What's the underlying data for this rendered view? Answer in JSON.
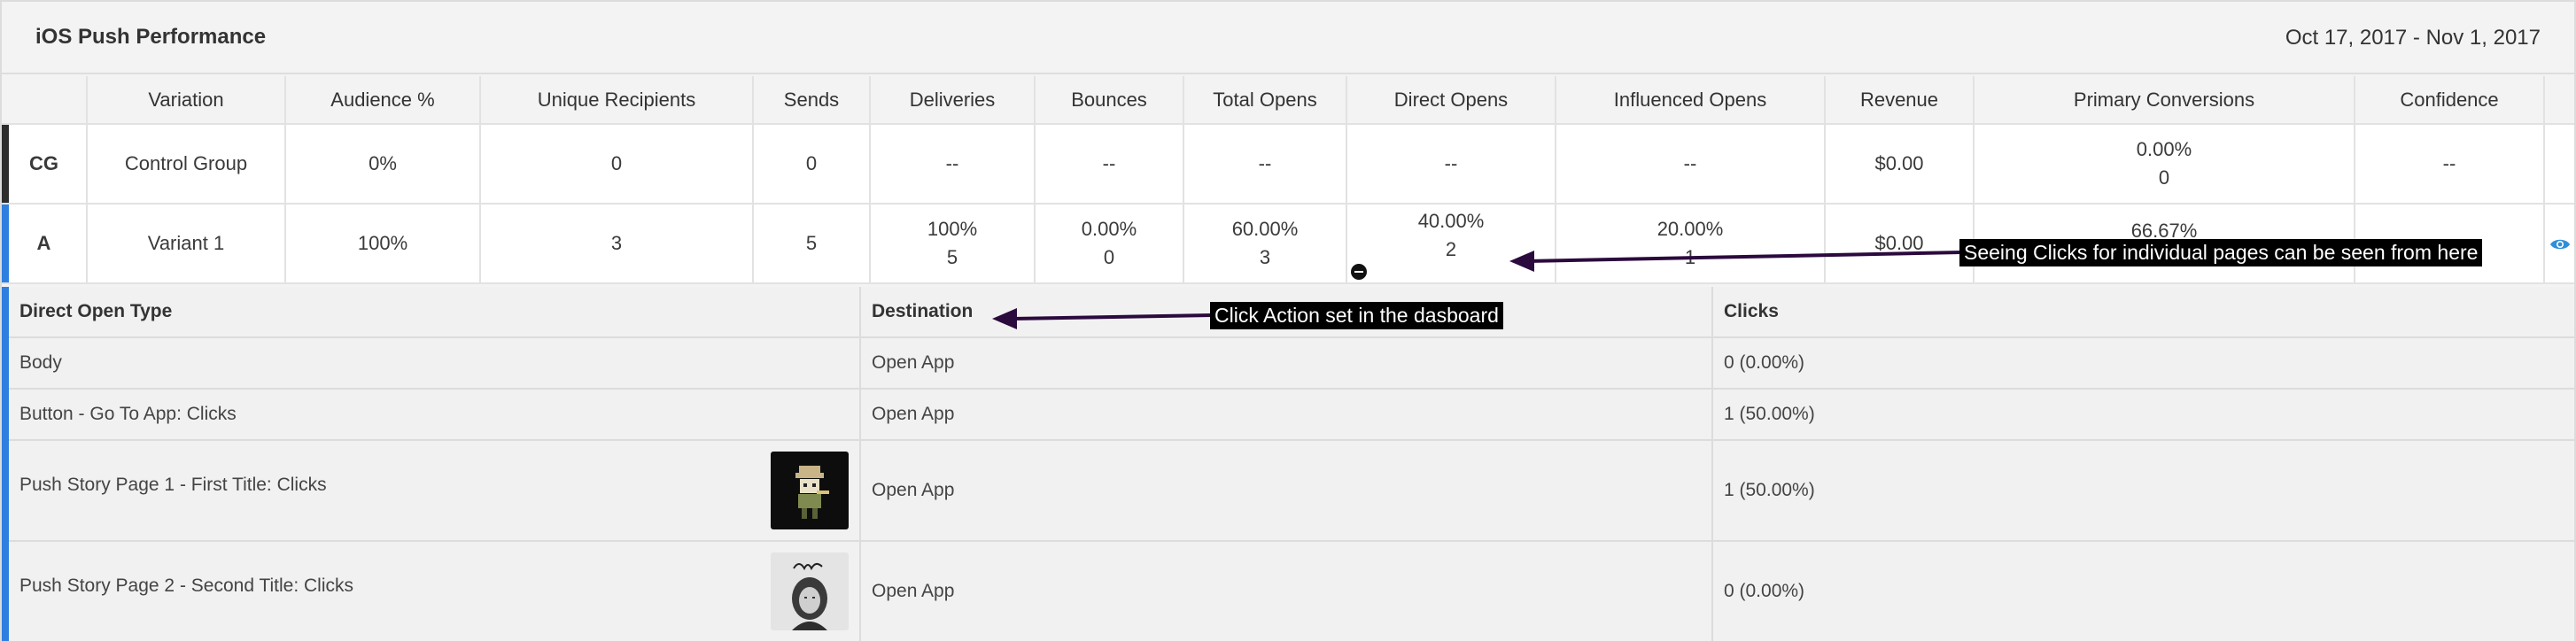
{
  "header": {
    "title": "iOS Push Performance",
    "date_range": "Oct 17, 2017 - Nov 1, 2017"
  },
  "metrics": {
    "columns": [
      "",
      "Variation",
      "Audience %",
      "Unique Recipients",
      "Sends",
      "Deliveries",
      "Bounces",
      "Total Opens",
      "Direct Opens",
      "Influenced Opens",
      "Revenue",
      "Primary Conversions",
      "Confidence",
      ""
    ],
    "rows": [
      {
        "key": "CG",
        "variation": "Control Group",
        "audience": "0%",
        "unique_recipients": "0",
        "sends": "0",
        "deliveries": "--",
        "bounces": "--",
        "total_opens": "--",
        "direct_opens": "--",
        "influenced_opens": "--",
        "revenue": "$0.00",
        "primary_conversions_pct": "0.00%",
        "primary_conversions_count": "0",
        "confidence": "--",
        "accent": "#2d2d2d"
      },
      {
        "key": "A",
        "variation": "Variant 1",
        "audience": "100%",
        "unique_recipients": "3",
        "sends": "5",
        "deliveries_pct": "100%",
        "deliveries_count": "5",
        "bounces_pct": "0.00%",
        "bounces_count": "0",
        "total_opens_pct": "60.00%",
        "total_opens_count": "3",
        "direct_opens_pct": "40.00%",
        "direct_opens_count": "2",
        "influenced_opens_pct": "20.00%",
        "influenced_opens_count": "1",
        "revenue": "$0.00",
        "primary_conversions_pct": "66.67%",
        "confidence": "",
        "accent": "#2f7fe0",
        "action_icon": "eye-icon",
        "expand_icon": "minus-circle-icon"
      }
    ]
  },
  "direct_open_detail": {
    "headers": {
      "type": "Direct Open Type",
      "destination": "Destination",
      "clicks": "Clicks"
    },
    "rows": [
      {
        "type": "Body",
        "destination": "Open App",
        "clicks": "0 (0.00%)"
      },
      {
        "type": "Button - Go To App: Clicks",
        "destination": "Open App",
        "clicks": "1 (50.00%)"
      },
      {
        "type": "Push Story Page 1 - First Title: Clicks",
        "destination": "Open App",
        "clicks": "1 (50.00%)",
        "thumbnail": "robot-figure-image"
      },
      {
        "type": "Push Story Page 2 - Second Title: Clicks",
        "destination": "Open App",
        "clicks": "0 (0.00%)",
        "thumbnail": "portrait-photo-image"
      }
    ]
  },
  "annotations": {
    "pages_note": "Seeing Clicks for individual pages can be seen from here",
    "click_action_note": "Click Action set in the dasboard",
    "arrow_color": "#2b0a3d"
  }
}
